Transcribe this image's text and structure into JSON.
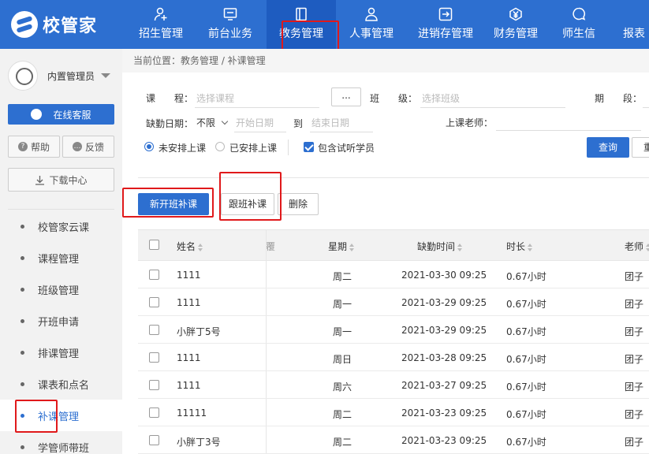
{
  "app": {
    "logo_text": "校管家"
  },
  "nav": [
    {
      "label": "招生管理",
      "icon": "person-add-icon"
    },
    {
      "label": "前台业务",
      "icon": "monitor-icon"
    },
    {
      "label": "教务管理",
      "icon": "book-icon",
      "active": true
    },
    {
      "label": "人事管理",
      "icon": "person-icon"
    },
    {
      "label": "进销存管理",
      "icon": "inventory-icon"
    },
    {
      "label": "财务管理",
      "icon": "yen-icon"
    },
    {
      "label": "师生信",
      "icon": "chat-icon"
    },
    {
      "label": "报表"
    }
  ],
  "sidebar": {
    "user_name": "内置管理员",
    "service_label": "在线客服",
    "help_label": "帮助",
    "feedback_label": "反馈",
    "download_label": "下载中心",
    "items": [
      {
        "label": "校管家云课"
      },
      {
        "label": "课程管理"
      },
      {
        "label": "班级管理"
      },
      {
        "label": "开班申请"
      },
      {
        "label": "排课管理"
      },
      {
        "label": "课表和点名"
      },
      {
        "label": "补课管理",
        "active": true
      },
      {
        "label": "学管师带班"
      }
    ]
  },
  "breadcrumb": "当前位置：教务管理 / 补课管理",
  "filters": {
    "course_label": "课　　程：",
    "course_placeholder": "选择课程",
    "more_button": "...",
    "class_label": "班　　级：",
    "class_placeholder": "选择班级",
    "period_label": "期　　段：",
    "period_value": "",
    "absence_date_label": "缺勤日期：",
    "absence_date_mode": "不限",
    "start_date_placeholder": "开始日期",
    "to_label": "到",
    "end_date_placeholder": "结束日期",
    "teacher_label": "上课老师：",
    "radio_unscheduled": "未安排上课",
    "radio_scheduled": "已安排上课",
    "include_trial_label": "包含试听学员",
    "query_button": "查询",
    "reset_button": "重置"
  },
  "actions": {
    "new_class_makeup": "新开班补课",
    "follow_class_makeup": "跟班补课",
    "delete": "删除"
  },
  "table": {
    "headers": {
      "name": "姓名",
      "week": "星期",
      "absence_time": "缺勤时间",
      "duration": "时长",
      "teacher": "老师"
    },
    "rows": [
      {
        "name": "1111",
        "week": "周二",
        "absence_time": "2021-03-30 09:25",
        "duration": "0.67小时",
        "teacher": "团子（"
      },
      {
        "name": "1111",
        "week": "周一",
        "absence_time": "2021-03-29 09:25",
        "duration": "0.67小时",
        "teacher": "团子（"
      },
      {
        "name": "小胖丁5号",
        "week": "周一",
        "absence_time": "2021-03-29 09:25",
        "duration": "0.67小时",
        "teacher": "团子（"
      },
      {
        "name": "1111",
        "week": "周日",
        "absence_time": "2021-03-28 09:25",
        "duration": "0.67小时",
        "teacher": "团子（"
      },
      {
        "name": "1111",
        "week": "周六",
        "absence_time": "2021-03-27 09:25",
        "duration": "0.67小时",
        "teacher": "团子（"
      },
      {
        "name": "11111",
        "week": "周二",
        "absence_time": "2021-03-23 09:25",
        "duration": "0.67小时",
        "teacher": "团子（"
      },
      {
        "name": "小胖丁3号",
        "week": "周二",
        "absence_time": "2021-03-23 09:25",
        "duration": "0.67小时",
        "teacher": "团子（"
      }
    ]
  },
  "colors": {
    "primary": "#2d6fd0",
    "highlight": "#e0191b"
  }
}
